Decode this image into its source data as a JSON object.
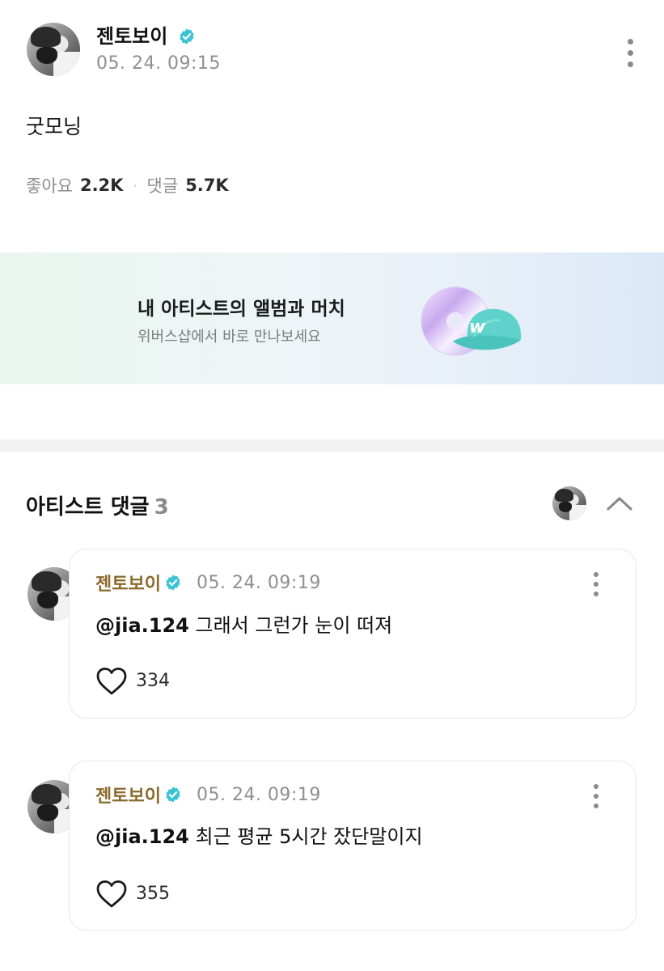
{
  "post": {
    "author": "젠토보이",
    "time": "05. 24. 09:15",
    "body": "굿모닝",
    "likes_label": "좋아요",
    "likes_count": "2.2K",
    "separator": "·",
    "comments_label": "댓글",
    "comments_count": "5.7K"
  },
  "banner": {
    "title": "내 아티스트의 앨범과 머치",
    "subtitle": "위버스샵에서 바로 만나보세요",
    "cap_letter": "w"
  },
  "artist_comments": {
    "title": "아티스트 댓글",
    "count": "3",
    "items": [
      {
        "author": "젠토보이",
        "time": "05. 24. 09:19",
        "mention": "@jia.124",
        "text": "그래서 그런가 눈이 떠져",
        "likes": "334"
      },
      {
        "author": "젠토보이",
        "time": "05. 24. 09:19",
        "mention": "@jia.124",
        "text": "최근 평균 5시간 잤단말이지",
        "likes": "355"
      }
    ]
  },
  "colors": {
    "verified": "#3cc3d3",
    "artist_name": "#8b6a2b",
    "muted": "#8f8f8f"
  },
  "icons": [
    "verified-badge-icon",
    "more-vertical-icon",
    "chevron-up-icon",
    "heart-icon",
    "album-cd-icon",
    "cap-icon"
  ]
}
